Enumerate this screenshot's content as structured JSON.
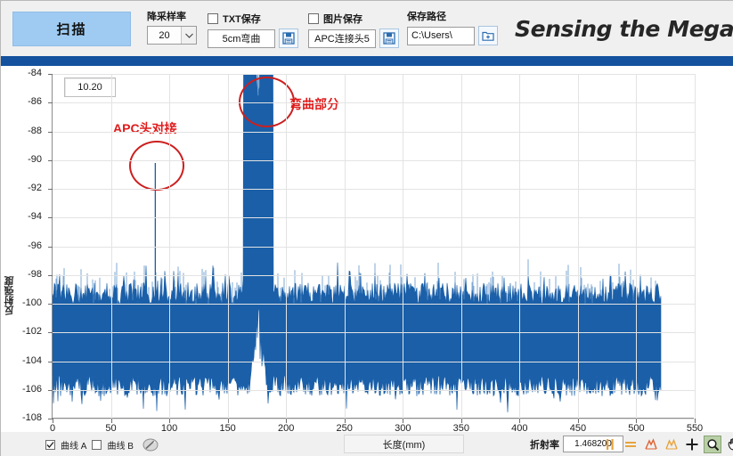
{
  "toolbar": {
    "scan_button": "扫描",
    "downsample": {
      "label": "降采样率",
      "value": "20",
      "icon": "chevron-down-icon"
    },
    "txt_save": {
      "checkbox_label": "TXT保存",
      "checked": false,
      "filename": "5cm弯曲",
      "save_icon": "floppy-disk-icon"
    },
    "image_save": {
      "checkbox_label": "图片保存",
      "checked": false,
      "filename": "APC连接头5",
      "save_icon": "floppy-disk-icon"
    },
    "save_path": {
      "label": "保存路径",
      "value": "C:\\Users\\",
      "browse_icon": "folder-add-icon"
    },
    "logo": {
      "text": "Sensing the Mega",
      "icon": "company-swoosh-logo-icon",
      "color": "#14519e"
    }
  },
  "chart_value_box": "10.20",
  "annotations": [
    {
      "text": "APC头对接",
      "color": "#e01b1b"
    },
    {
      "text": "弯曲部分",
      "color": "#e01b1b"
    }
  ],
  "bottom": {
    "curve_a": {
      "label": "曲线 A",
      "checked": true
    },
    "curve_b": {
      "label": "曲线 B",
      "checked": false
    },
    "pen_icon": "pen-tool-icon",
    "xaxis_label_box": "长度(mm)",
    "refractive_index": {
      "label": "折射率",
      "value": "1.468200"
    },
    "tools": [
      {
        "name": "cursor-tool-icon",
        "glyph": "||",
        "color": "#e8a33d",
        "active": false
      },
      {
        "name": "horizontal-lines-tool-icon",
        "glyph": "=",
        "color": "#e8a33d",
        "active": false
      },
      {
        "name": "zoom-peak-tool-icon",
        "glyph": "⋀",
        "color": "#e06030",
        "active": false
      },
      {
        "name": "peak-select-tool-icon",
        "glyph": "⋀",
        "color": "#e8a33d",
        "active": false
      },
      {
        "name": "crosshair-tool-icon",
        "glyph": "+",
        "color": "#1c1c1c",
        "active": false
      },
      {
        "name": "zoom-magnifier-tool-icon",
        "glyph": "⌕",
        "color": "#1c1c1c",
        "active": true
      },
      {
        "name": "pan-hand-tool-icon",
        "glyph": "✋",
        "color": "#1c1c1c",
        "active": false
      }
    ]
  },
  "chart_data": {
    "type": "line",
    "title": "",
    "xlabel": "长度(mm)",
    "ylabel": "反射强度",
    "xlim": [
      0,
      550
    ],
    "ylim": [
      -108,
      -84
    ],
    "xticks": [
      0,
      50,
      100,
      150,
      200,
      250,
      300,
      350,
      400,
      450,
      500,
      550
    ],
    "yticks": [
      -84,
      -86,
      -88,
      -90,
      -92,
      -94,
      -96,
      -98,
      -100,
      -102,
      -104,
      -106,
      -108
    ],
    "grid": true,
    "legend_position": "bottom-left",
    "series": [
      {
        "name": "曲线 A",
        "color": "#1a5fa8",
        "visible": true,
        "description": "OTDR-like reflection trace: dense noise band between -99.5 and -105.5 dB from 0 to 521 mm, with a narrow reflection spike at 88 mm reaching -90.2 dB (APC connector butt joint) and a large broad peak centered at 176 mm reaching -85.5 dB (bend section).",
        "data_end_mm": 521,
        "noise_band": {
          "top_db": -99.3,
          "bottom_db": -105.7,
          "mean_db": -102.5
        },
        "features": [
          {
            "label": "APC头对接",
            "x_mm": 88,
            "peak_db": -90.2,
            "width_mm": 1
          },
          {
            "label": "弯曲部分",
            "x_mm": 176,
            "peak_db": -85.5,
            "width_mm": 8
          }
        ]
      },
      {
        "name": "曲线 B",
        "color": "#cf7a1e",
        "visible": false,
        "description": "hidden second trace"
      }
    ]
  }
}
